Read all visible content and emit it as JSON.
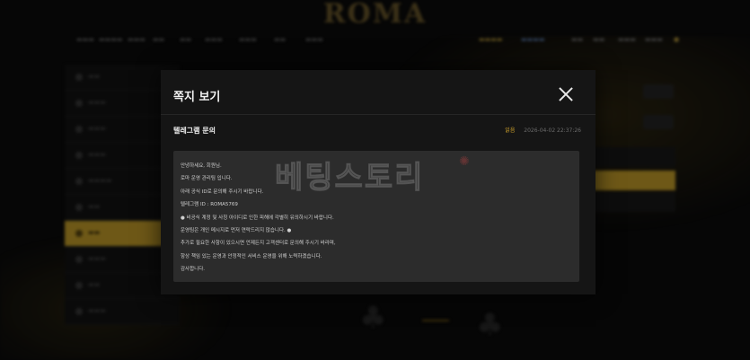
{
  "background": {
    "logo": "ROMA"
  },
  "modal": {
    "title": "쪽지 보기",
    "subject": "텔레그램 문의",
    "status": "읽음",
    "date": "2026-04-02 22:37:26",
    "body_lines": [
      "안녕하세요, 회원님.",
      "로마 운영 관리팀 입니다.",
      "아래 공식 ID로 문의해 주시기 바랍니다.",
      "텔레그램 ID : ROMA5769",
      "● 비공식 계정 및 사칭 아이디로 인한 피해에 각별히 유의하시기 바랍니다.",
      "운영팀은 개인 메시지로 먼저 연락드리지 않습니다. ●",
      "추가로 필요한 사항이 있으시면 언제든지 고객센터로 문의해 주시기 바라며,",
      "항상 책임 있는 운영과 안정적인 서비스 운영을 위해 노력하겠습니다.",
      "감사합니다."
    ],
    "watermark": "베팅스토리"
  },
  "colors": {
    "accent_gold": "#c8a12a",
    "status_read": "#d8a92c",
    "modal_bg": "#151515",
    "body_bg": "#2c2c2c"
  },
  "icons": {
    "close": "close-icon"
  }
}
